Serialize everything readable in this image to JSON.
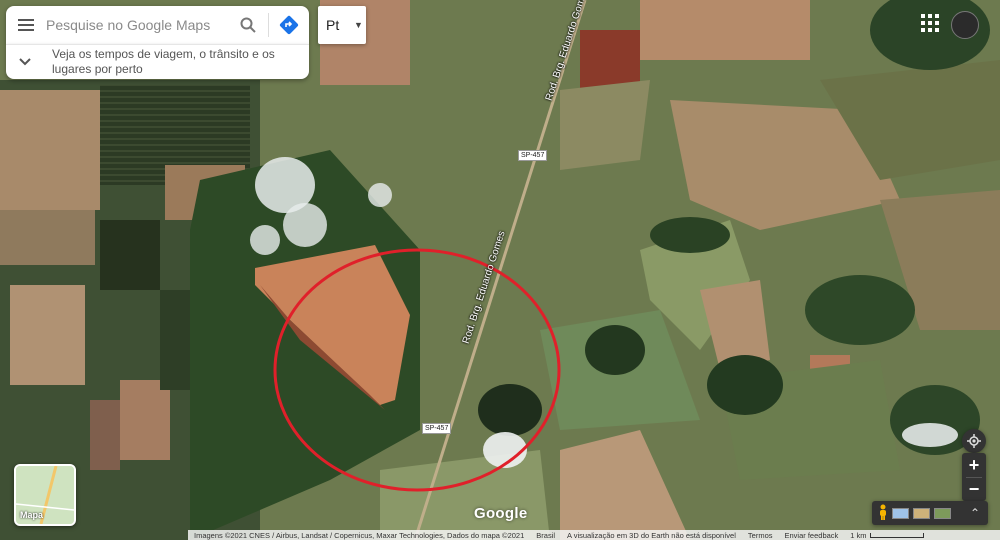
{
  "search": {
    "placeholder": "Pesquise no Google Maps",
    "explore_text": "Veja os tempos de viagem, o trânsito e os lugares por perto"
  },
  "language_button": "Pt",
  "map": {
    "road_labels": [
      "SP-457",
      "SP-457"
    ],
    "road_names": [
      "Rod. Brg. Eduardo Gomes",
      "Rod. Brg. Eduardo Gomes"
    ],
    "layer_toggle_label": "Mapa",
    "logo_text": "Google",
    "zoom_in": "+",
    "zoom_out": "−"
  },
  "footer": {
    "attribution": "Imagens ©2021 CNES / Airbus, Landsat / Copernicus, Maxar Technologies, Dados do mapa ©2021",
    "country": "Brasil",
    "notice": "A visualização em 3D do Earth não está disponível",
    "terms": "Termos",
    "feedback": "Enviar feedback",
    "scale": "1 km"
  },
  "colors": {
    "annotation_circle": "#e0202a",
    "directions_blue": "#1a73e8"
  },
  "icons": [
    "menu-icon",
    "search-icon",
    "directions-icon",
    "chevron-down-icon",
    "apps-grid-icon",
    "my-location-icon",
    "pegman-icon"
  ]
}
